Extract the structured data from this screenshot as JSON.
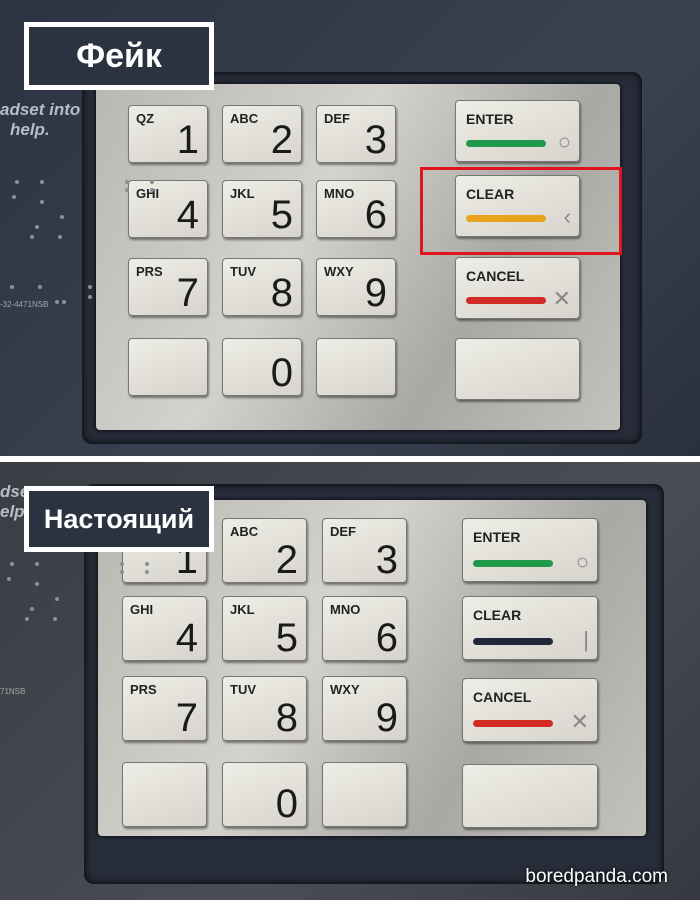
{
  "fake": {
    "label": "Фейк",
    "side_text_1": "adset into",
    "side_text_2": "help.",
    "code": "-32-4471NSB",
    "digits": [
      {
        "letters": "QZ",
        "digit": "1"
      },
      {
        "letters": "ABC",
        "digit": "2"
      },
      {
        "letters": "DEF",
        "digit": "3"
      },
      {
        "letters": "GHI",
        "digit": "4"
      },
      {
        "letters": "JKL",
        "digit": "5"
      },
      {
        "letters": "MNO",
        "digit": "6"
      },
      {
        "letters": "PRS",
        "digit": "7"
      },
      {
        "letters": "TUV",
        "digit": "8"
      },
      {
        "letters": "WXY",
        "digit": "9"
      },
      {
        "letters": "",
        "digit": ""
      },
      {
        "letters": "",
        "digit": "0"
      },
      {
        "letters": "",
        "digit": ""
      }
    ],
    "functions": [
      {
        "label": "ENTER",
        "color": "#1e9a4a",
        "icon": "○"
      },
      {
        "label": "CLEAR",
        "color": "#e8a21c",
        "icon": "‹"
      },
      {
        "label": "CANCEL",
        "color": "#d22a24",
        "icon": "✕"
      },
      {
        "label": "",
        "color": "",
        "icon": ""
      }
    ],
    "highlight_color": "#e0141c"
  },
  "real": {
    "label": "Настоящий",
    "side_text_1": "dset",
    "side_text_2": "elp.",
    "code": "71NSB",
    "digits": [
      {
        "letters": "",
        "digit": "1"
      },
      {
        "letters": "ABC",
        "digit": "2"
      },
      {
        "letters": "DEF",
        "digit": "3"
      },
      {
        "letters": "GHI",
        "digit": "4"
      },
      {
        "letters": "JKL",
        "digit": "5"
      },
      {
        "letters": "MNO",
        "digit": "6"
      },
      {
        "letters": "PRS",
        "digit": "7"
      },
      {
        "letters": "TUV",
        "digit": "8"
      },
      {
        "letters": "WXY",
        "digit": "9"
      },
      {
        "letters": "",
        "digit": ""
      },
      {
        "letters": "",
        "digit": "0"
      },
      {
        "letters": "",
        "digit": ""
      }
    ],
    "functions": [
      {
        "label": "ENTER",
        "color": "#1e9a4a",
        "icon": "○"
      },
      {
        "label": "CLEAR",
        "color": "#1e2838",
        "icon": "|"
      },
      {
        "label": "CANCEL",
        "color": "#d22a24",
        "icon": "✕"
      },
      {
        "label": "",
        "color": "",
        "icon": ""
      }
    ]
  },
  "watermark": "boredpanda.com"
}
